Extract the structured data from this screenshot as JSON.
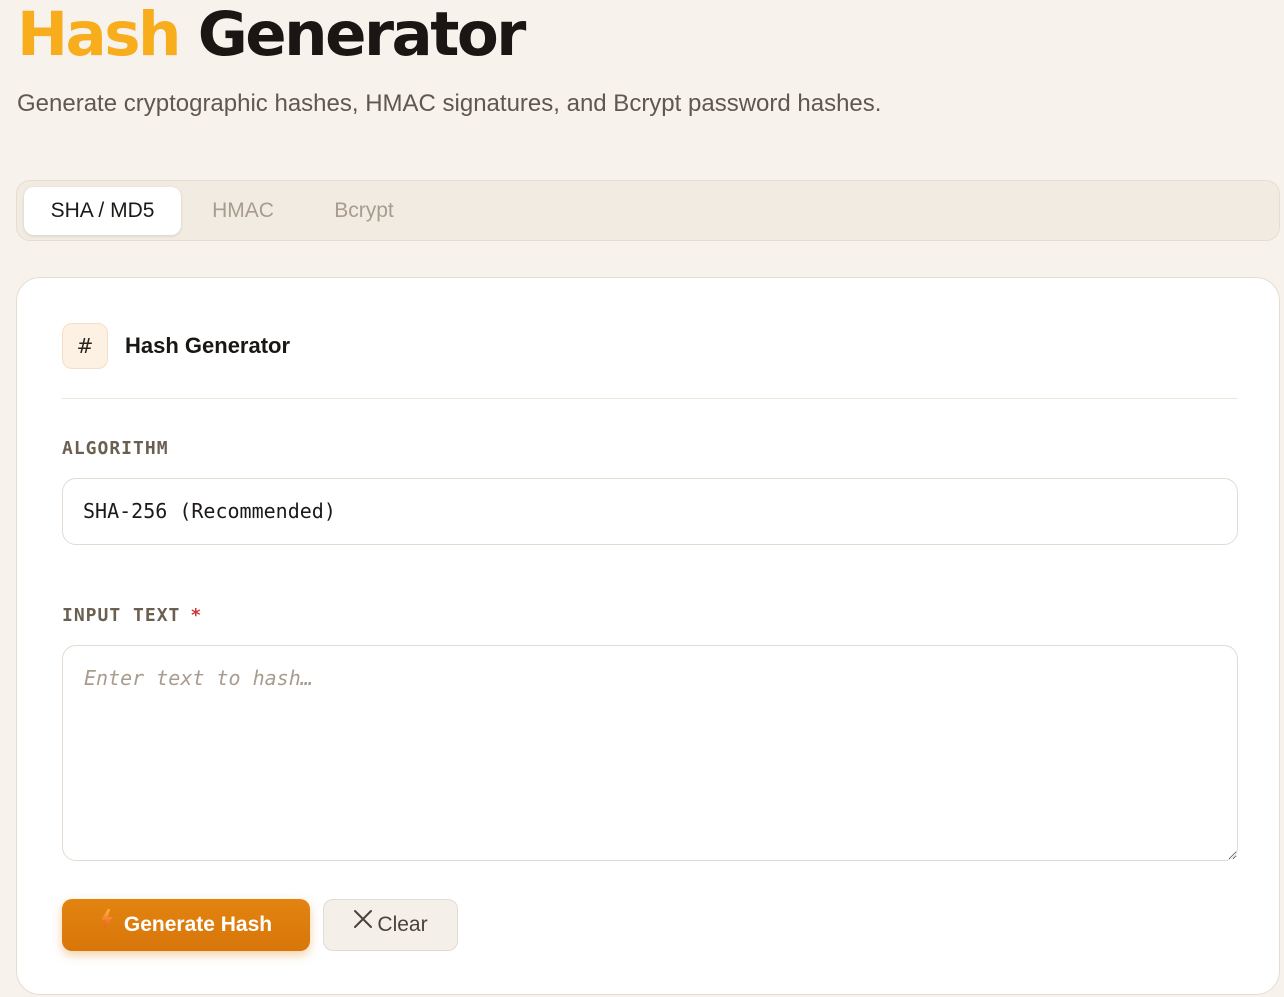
{
  "header": {
    "title_accent": "Hash",
    "title_rest": "Generator",
    "subtitle": "Generate cryptographic hashes, HMAC signatures, and Bcrypt password hashes."
  },
  "tabs": [
    {
      "label": "SHA / MD5",
      "active": true
    },
    {
      "label": "HMAC",
      "active": false
    },
    {
      "label": "Bcrypt",
      "active": false
    }
  ],
  "card": {
    "icon_glyph": "#",
    "title": "Hash Generator",
    "algorithm_label": "ALGORITHM",
    "algorithm_value": "SHA-256 (Recommended)",
    "input_label": "INPUT TEXT",
    "required_mark": "*",
    "input_placeholder": "Enter text to hash…",
    "input_value": ""
  },
  "actions": {
    "generate_label": "Generate Hash",
    "clear_label": "Clear"
  },
  "icons": {
    "generate": "bolt-icon",
    "clear": "close-icon",
    "card": "hash-icon"
  },
  "colors": {
    "accent": "#f7ad1c",
    "primary_button": "#d97706",
    "background": "#f7f2ec",
    "required": "#d13434"
  }
}
